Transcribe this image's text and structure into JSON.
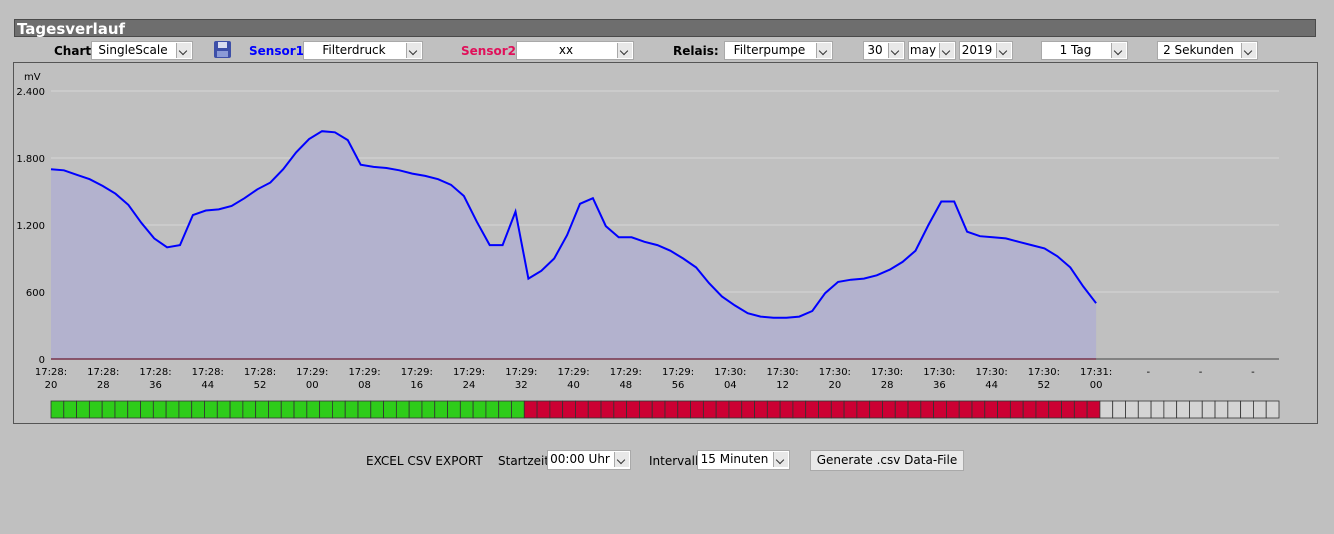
{
  "title": "Tagesverlauf",
  "toolbar": {
    "chart_label": "Chart:",
    "chart_value": "SingleScale",
    "sensor1_label": "Sensor1:",
    "sensor1_value": "Filterdruck",
    "sensor2_label": "Sensor2:",
    "sensor2_value": "xx",
    "relais_label": "Relais:",
    "relais_value": "Filterpumpe",
    "day": "30",
    "month": "may",
    "year": "2019",
    "range": "1 Tag",
    "interval": "2 Sekunden"
  },
  "colors": {
    "sensor1": "#0000ff",
    "sensor2": "#e0105a",
    "fill": "#b3b2ce",
    "relay_on": "#2ecc1a",
    "relay_off": "#cc0033",
    "relay_empty": "#d4d4d4"
  },
  "chart_data": {
    "type": "area",
    "ylabel": "mV",
    "ylim": [
      0,
      2400
    ],
    "yticks": [
      "0",
      "600",
      "1.200",
      "1.800",
      "2.400"
    ],
    "xticks": [
      [
        "17:28:",
        "20"
      ],
      [
        "17:28:",
        "28"
      ],
      [
        "17:28:",
        "36"
      ],
      [
        "17:28:",
        "44"
      ],
      [
        "17:28:",
        "52"
      ],
      [
        "17:29:",
        "00"
      ],
      [
        "17:29:",
        "08"
      ],
      [
        "17:29:",
        "16"
      ],
      [
        "17:29:",
        "24"
      ],
      [
        "17:29:",
        "32"
      ],
      [
        "17:29:",
        "40"
      ],
      [
        "17:29:",
        "48"
      ],
      [
        "17:29:",
        "56"
      ],
      [
        "17:30:",
        "04"
      ],
      [
        "17:30:",
        "12"
      ],
      [
        "17:30:",
        "20"
      ],
      [
        "17:30:",
        "28"
      ],
      [
        "17:30:",
        "36"
      ],
      [
        "17:30:",
        "44"
      ],
      [
        "17:30:",
        "52"
      ],
      [
        "17:31:",
        "00"
      ],
      [
        "-",
        ""
      ],
      [
        "-",
        ""
      ],
      [
        "-",
        ""
      ]
    ],
    "series": [
      {
        "values": [
          1700,
          1690,
          1650,
          1610,
          1550,
          1480,
          1380,
          1220,
          1080,
          1000,
          1020,
          1290,
          1330,
          1340,
          1370,
          1440,
          1520,
          1580,
          1700,
          1850,
          1970,
          2040,
          2030,
          1960,
          1740,
          1720,
          1710,
          1690,
          1660,
          1640,
          1610,
          1560,
          1460,
          1230,
          1020,
          1020,
          1320,
          720,
          790,
          900,
          1110,
          1390,
          1440,
          1190,
          1090,
          1090,
          1050,
          1020,
          970,
          900,
          820,
          680,
          560,
          480,
          410,
          380,
          370,
          370,
          380,
          430,
          590,
          690,
          710,
          720,
          750,
          800,
          870,
          970,
          1200,
          1410,
          1410,
          1140,
          1100,
          1090,
          1080,
          1050,
          1020,
          990,
          920,
          820,
          650,
          500
        ]
      },
      {
        "values": [
          0,
          0
        ]
      }
    ],
    "relay": {
      "on": 37,
      "off": 45,
      "empty": 14
    }
  },
  "export": {
    "title": "EXCEL CSV EXPORT",
    "start_label": "Startzeit:",
    "start_value": "00:00 Uhr",
    "interval_label": "Intervall:",
    "interval_value": "15 Minuten",
    "button": "Generate .csv Data-File"
  }
}
